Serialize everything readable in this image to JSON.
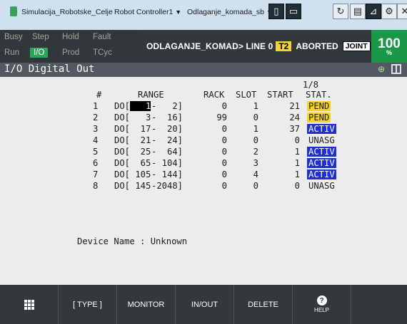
{
  "topbar": {
    "tabs": [
      {
        "label": "Simulacija_Robotske_Celje"
      },
      {
        "label": "Robot Controller1"
      },
      {
        "label": "Odlaganje_komada_sb"
      }
    ],
    "icons": [
      "tablet-icon",
      "keyboard-icon",
      "refresh-icon",
      "file-icon",
      "arm-icon",
      "settings-icon",
      "close-icon"
    ]
  },
  "status": {
    "leds": [
      {
        "label": "Busy",
        "on": false
      },
      {
        "label": "Step",
        "on": false
      },
      {
        "label": "Hold",
        "on": false
      },
      {
        "label": "Fault",
        "on": false
      },
      {
        "label": "Run",
        "on": false
      },
      {
        "label": "I/O",
        "on": true
      },
      {
        "label": "Prod",
        "on": false
      },
      {
        "label": "TCyc",
        "on": false
      }
    ],
    "program": "ODLAGANJE_KOMAD> LINE 0",
    "mode": "T2",
    "state": "ABORTED",
    "coord": "JOINT",
    "speed": "100",
    "speed_unit": "%"
  },
  "screen": {
    "title": "I/O Digital Out",
    "page": "1/8",
    "columns": {
      "num": "#",
      "range": "RANGE",
      "rack": "RACK",
      "slot": "SLOT",
      "start": "START",
      "stat": "STAT."
    },
    "rows": [
      {
        "num": "1",
        "range_prefix": "DO[",
        "range_a": "   1",
        "range_b": "-   2]",
        "rack": "0",
        "slot": "1",
        "start": "21",
        "stat": "PEND",
        "stat_kind": "pend",
        "cursor": true
      },
      {
        "num": "2",
        "range_prefix": "DO[",
        "range_a": "   3",
        "range_b": "-  16]",
        "rack": "99",
        "slot": "0",
        "start": "24",
        "stat": "PEND",
        "stat_kind": "pend",
        "cursor": false
      },
      {
        "num": "3",
        "range_prefix": "DO[",
        "range_a": "  17",
        "range_b": "-  20]",
        "rack": "0",
        "slot": "1",
        "start": "37",
        "stat": "ACTIV",
        "stat_kind": "activ",
        "cursor": false
      },
      {
        "num": "4",
        "range_prefix": "DO[",
        "range_a": "  21",
        "range_b": "-  24]",
        "rack": "0",
        "slot": "0",
        "start": "0",
        "stat": "UNASG",
        "stat_kind": "unasg",
        "cursor": false
      },
      {
        "num": "5",
        "range_prefix": "DO[",
        "range_a": "  25",
        "range_b": "-  64]",
        "rack": "0",
        "slot": "2",
        "start": "1",
        "stat": "ACTIV",
        "stat_kind": "activ",
        "cursor": false
      },
      {
        "num": "6",
        "range_prefix": "DO[",
        "range_a": "  65",
        "range_b": "- 104]",
        "rack": "0",
        "slot": "3",
        "start": "1",
        "stat": "ACTIV",
        "stat_kind": "activ",
        "cursor": false
      },
      {
        "num": "7",
        "range_prefix": "DO[",
        "range_a": " 105",
        "range_b": "- 144]",
        "rack": "0",
        "slot": "4",
        "start": "1",
        "stat": "ACTIV",
        "stat_kind": "activ",
        "cursor": false
      },
      {
        "num": "8",
        "range_prefix": "DO[",
        "range_a": " 145",
        "range_b": "-2048]",
        "rack": "0",
        "slot": "0",
        "start": "0",
        "stat": "UNASG",
        "stat_kind": "unasg",
        "cursor": false
      }
    ],
    "device_label": "Device Name : Unknown"
  },
  "softkeys": [
    {
      "label": "",
      "icon": "grid-icon"
    },
    {
      "label": "[ TYPE ]"
    },
    {
      "label": "MONITOR"
    },
    {
      "label": "IN/OUT"
    },
    {
      "label": "DELETE"
    },
    {
      "label": "HELP",
      "icon": "help-icon"
    },
    {
      "label": ""
    }
  ]
}
